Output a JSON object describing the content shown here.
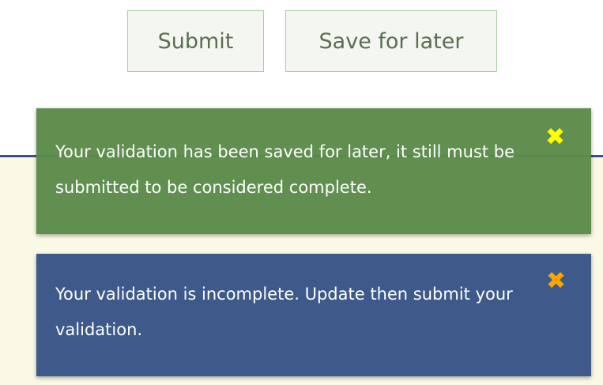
{
  "buttons": {
    "submit_label": "Submit",
    "save_label": "Save for later"
  },
  "toasts": [
    {
      "message": "Your validation has been saved for later, it still must be submitted to be considered complete.",
      "close_icon": "close-x-icon",
      "close_glyph": "✖",
      "color": "#5b8b49",
      "close_color": "#ffff00"
    },
    {
      "message": "Your validation is incomplete. Update then submit your validation.",
      "close_icon": "close-x-icon",
      "close_glyph": "✖",
      "color": "#3d5a8a",
      "close_color": "#ffa500"
    }
  ],
  "colors": {
    "button_border": "#a9cfa3",
    "button_text": "#5b6e54",
    "panel_background": "#f9f9e6",
    "panel_border": "#3b5381"
  }
}
